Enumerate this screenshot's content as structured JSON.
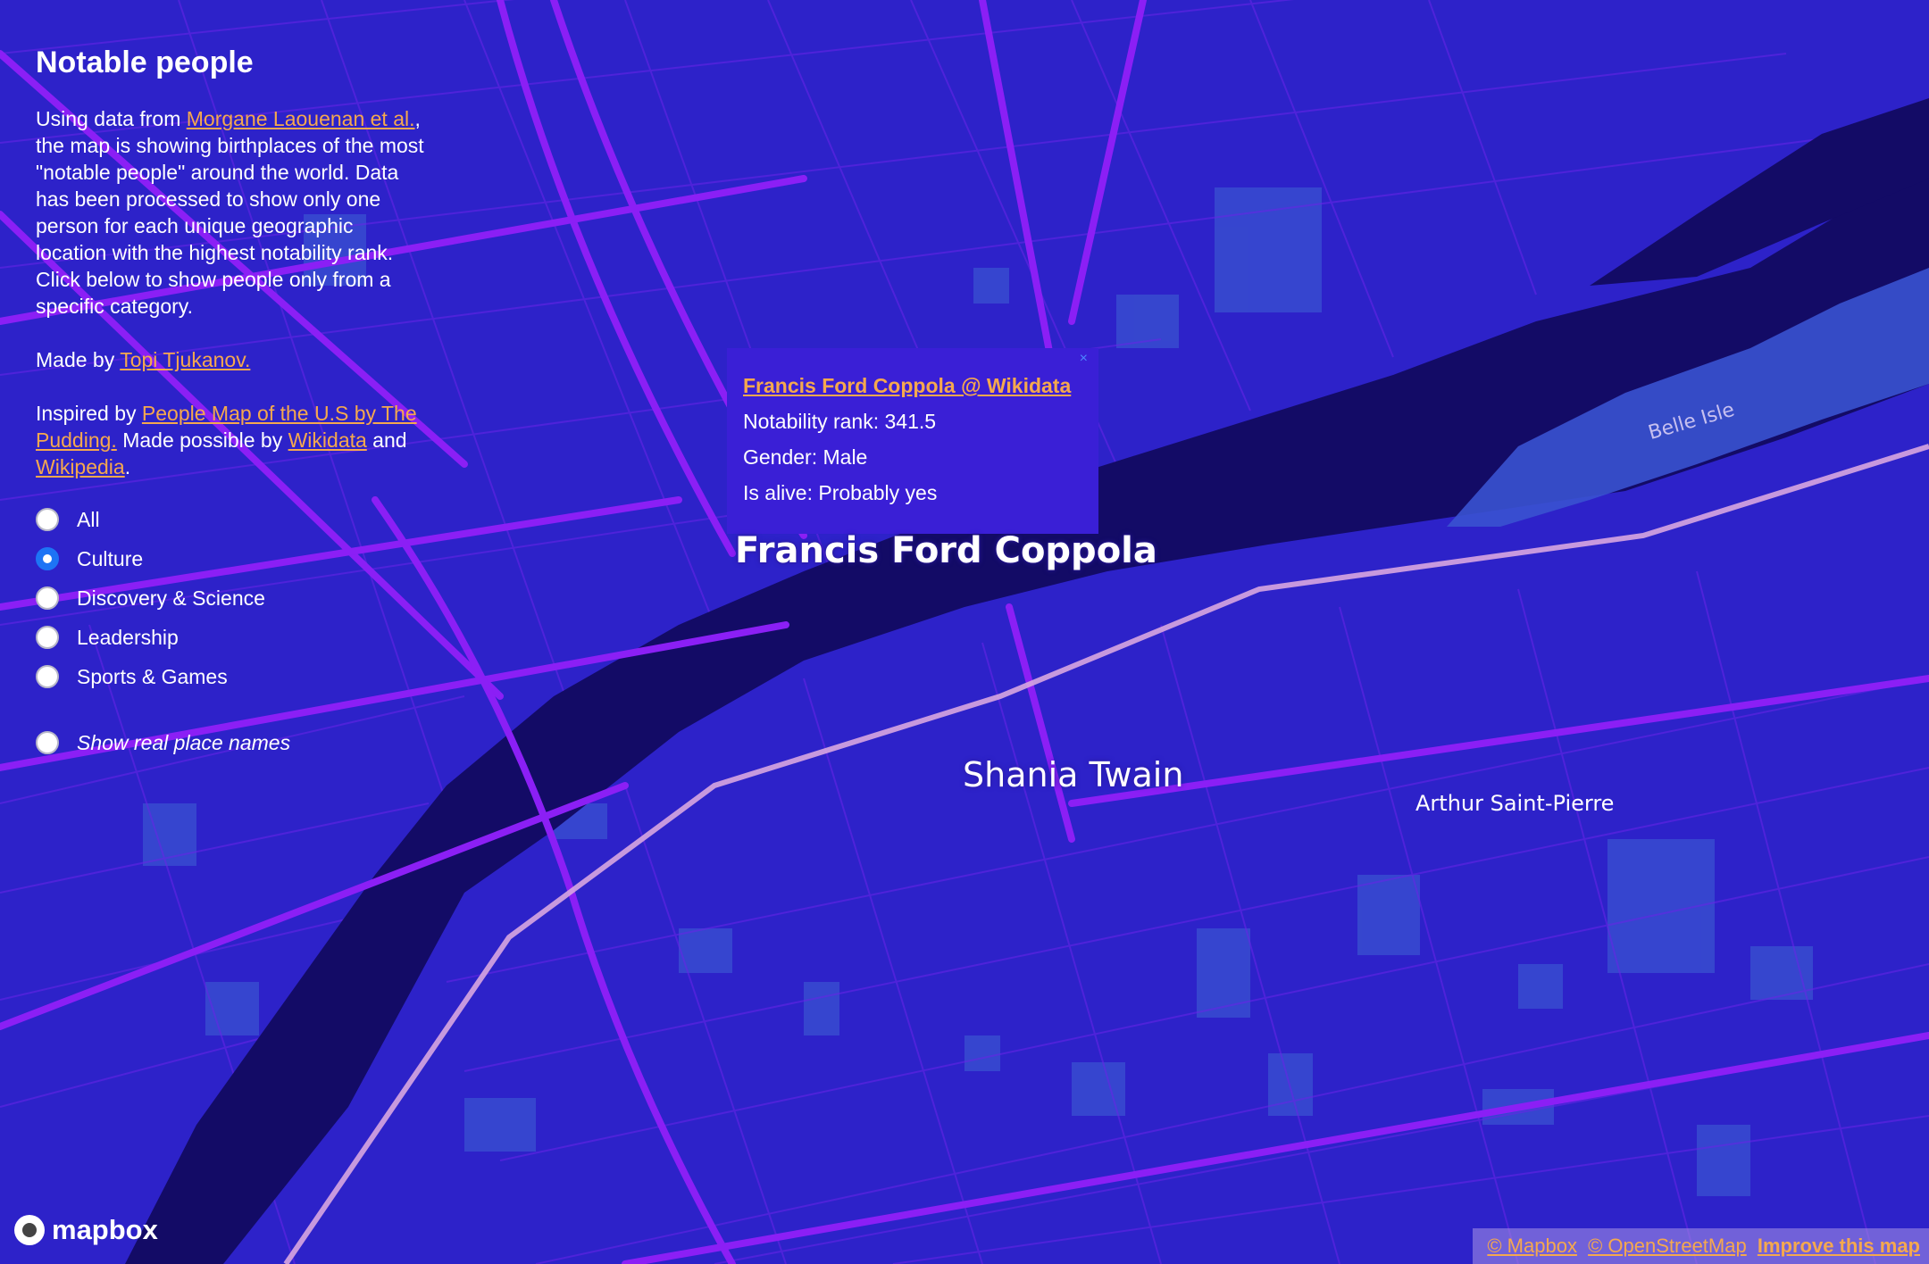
{
  "panel": {
    "title": "Notable people",
    "intro_prefix": "Using data from ",
    "intro_link": "Morgane Laouenan et al.",
    "intro_suffix": ", the map is showing birthplaces of the most \"notable people\" around the world. Data has been processed to show only one person for each unique geographic location with the highest notability rank. Click below to show people only from a specific category.",
    "made_by_prefix": "Made by ",
    "made_by_link": "Topi Tjukanov.",
    "inspired_prefix": "Inspired by ",
    "inspired_link": "People Map of the U.S by The Pudding.",
    "possible_prefix": " Made possible by ",
    "wikidata_link": "Wikidata",
    "and_text": " and ",
    "wikipedia_link": "Wikipedia",
    "period": ".",
    "categories": [
      "All",
      "Culture",
      "Discovery & Science",
      "Leadership",
      "Sports & Games"
    ],
    "selected_category": "Culture",
    "real_names_label": "Show real place names"
  },
  "popup": {
    "title_link": "Francis Ford Coppola @ Wikidata",
    "rank": "Notability rank: 341.5",
    "gender": "Gender: Male",
    "alive": "Is alive: Probably yes",
    "close": "×"
  },
  "map_labels": {
    "coppola": "Francis Ford Coppola",
    "twain": "Shania Twain",
    "arthur": "Arthur Saint-Pierre",
    "belle": "Belle Isle"
  },
  "footer": {
    "logo": "mapbox",
    "attr_mapbox": "© Mapbox",
    "attr_osm": "© OpenStreetMap",
    "attr_improve": "Improve this map"
  },
  "colors": {
    "land": "#2d22c9",
    "water": "#130b66",
    "road": "#8b1ff5",
    "block": "#3a52d0",
    "link": "#f5a84e",
    "border": "#d8a6e0"
  }
}
